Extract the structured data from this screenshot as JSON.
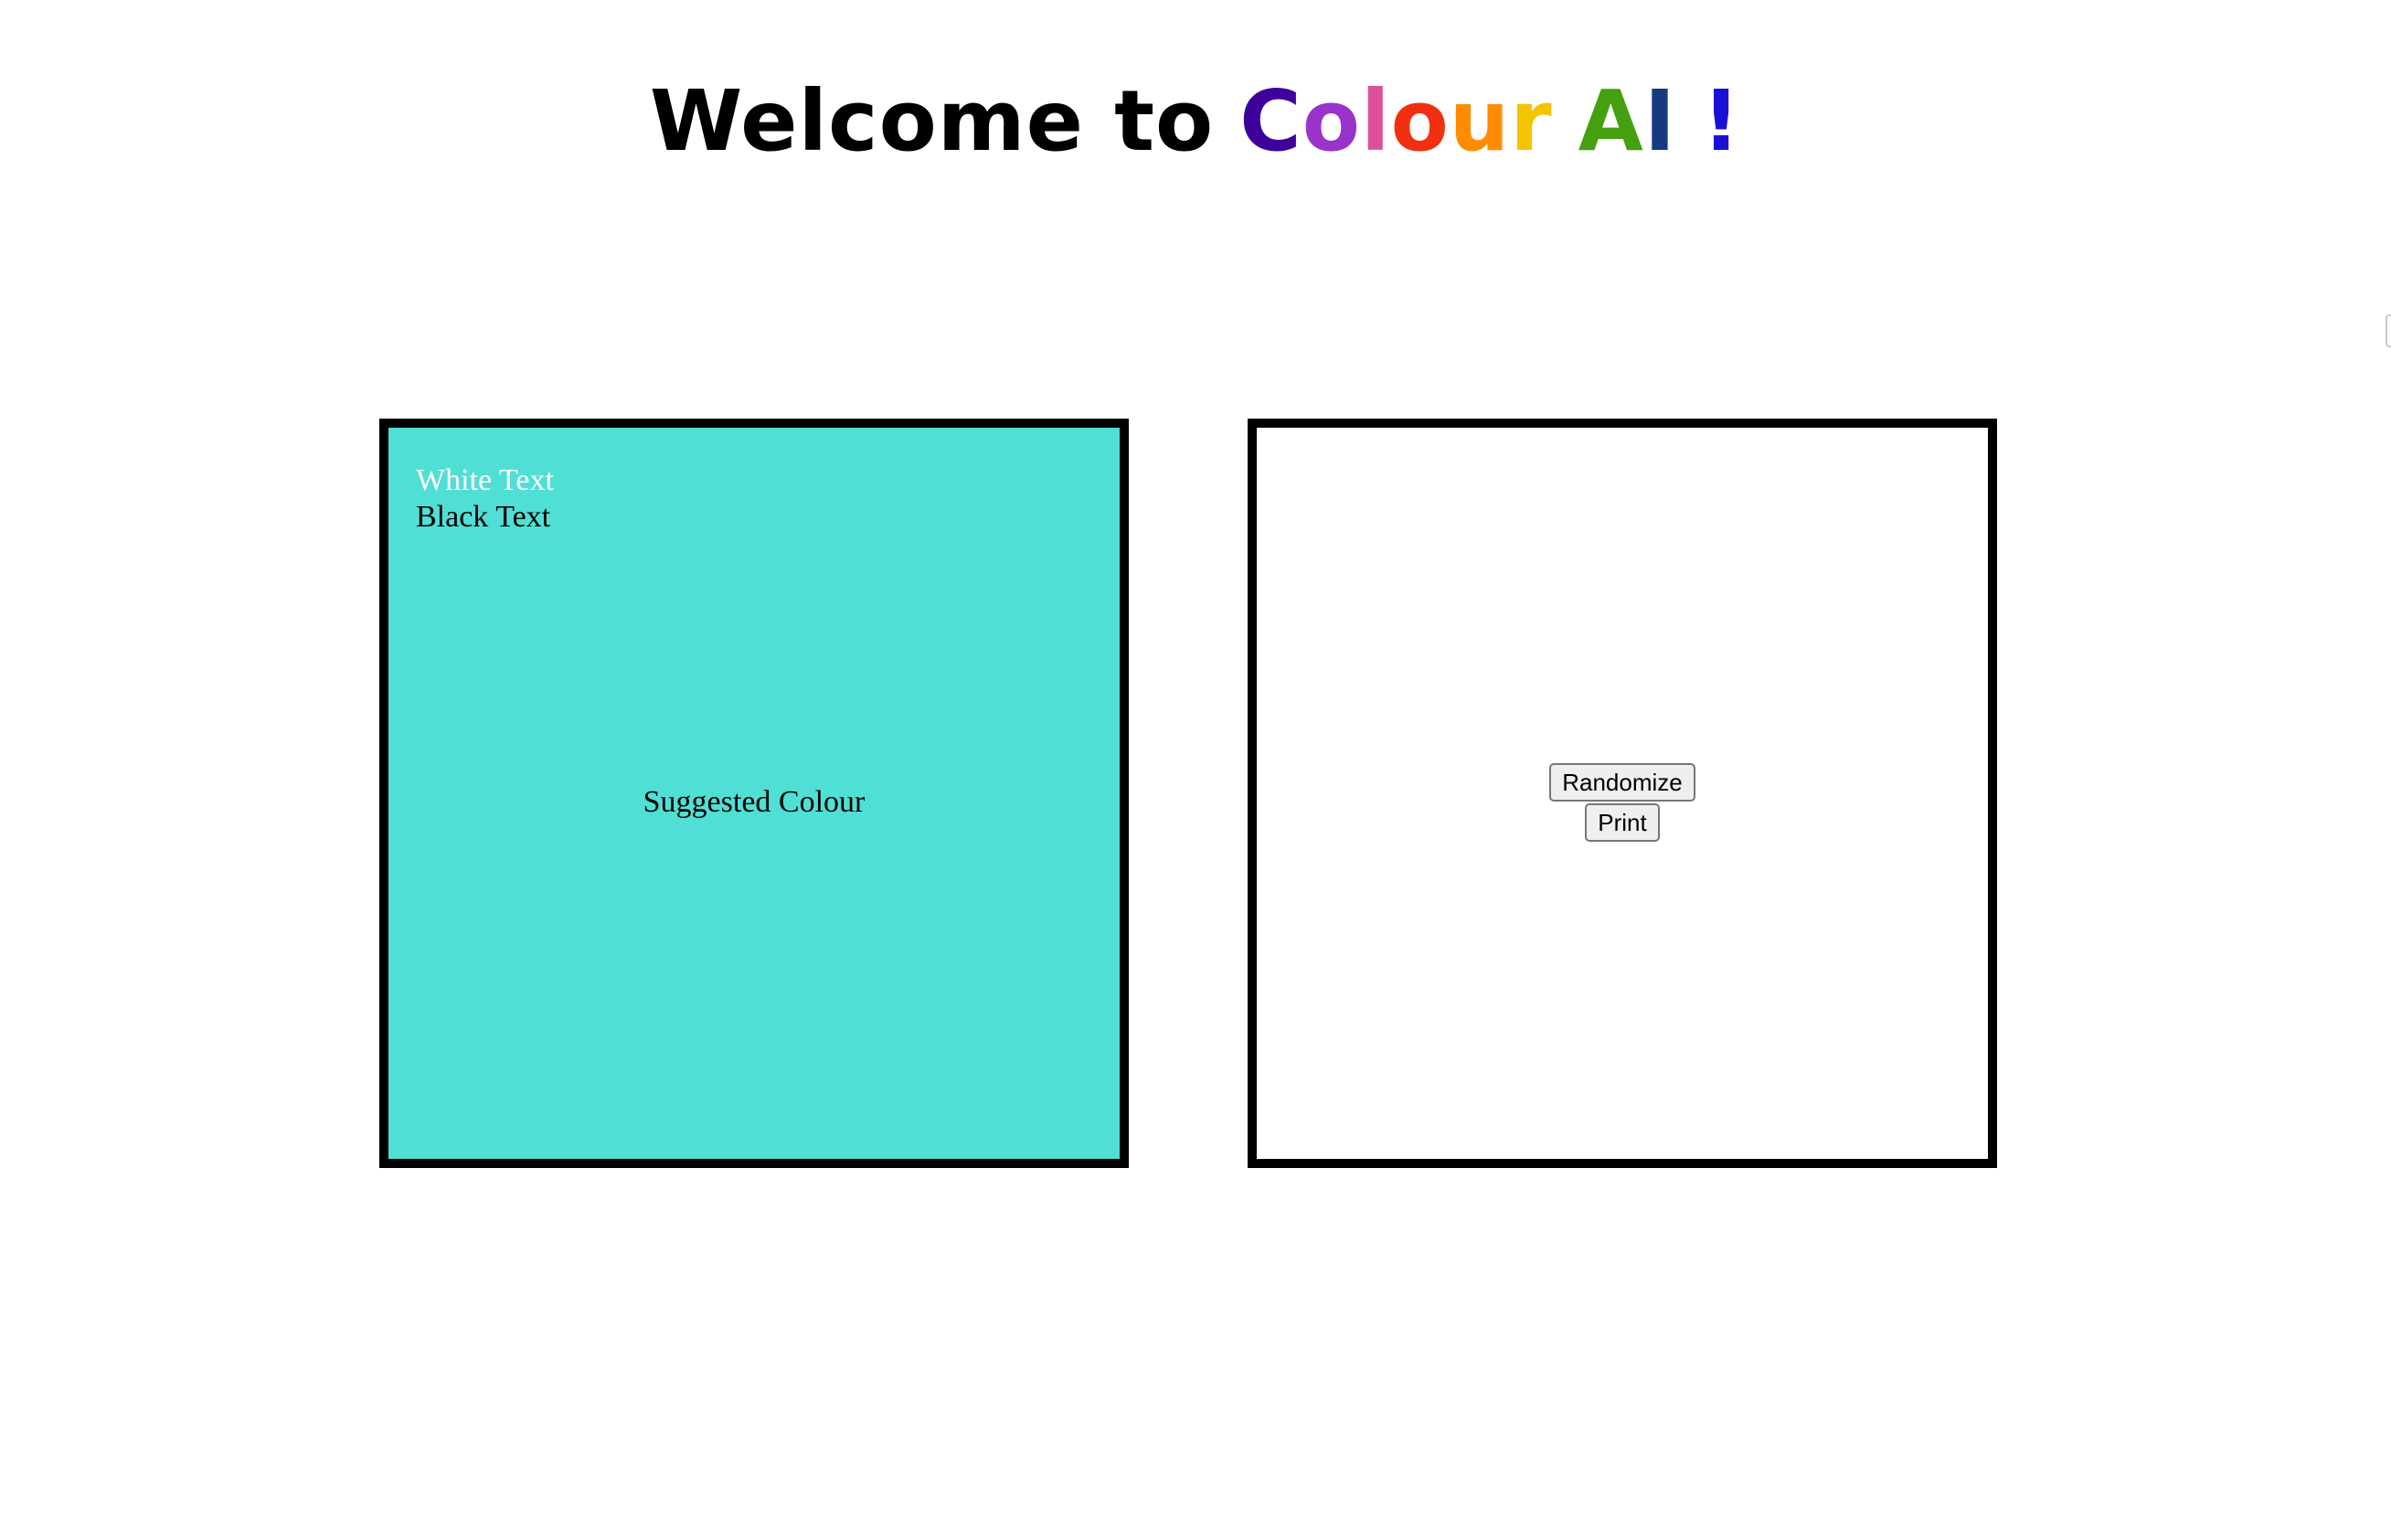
{
  "header": {
    "prefix": "Welcome to",
    "colour_letters": [
      {
        "ch": "C",
        "color": "#3d0099"
      },
      {
        "ch": "o",
        "color": "#9933cc"
      },
      {
        "ch": "l",
        "color": "#e0509a"
      },
      {
        "ch": "o",
        "color": "#f03010"
      },
      {
        "ch": "u",
        "color": "#ff8c00"
      },
      {
        "ch": "r",
        "color": "#f4c400"
      }
    ],
    "ai_letters": [
      {
        "ch": "A",
        "color": "#45a010"
      },
      {
        "ch": "I",
        "color": "#153a80"
      }
    ],
    "exclaim": {
      "ch": "!",
      "color": "#1a0fd6"
    }
  },
  "preview_panel": {
    "background_color": "#50dfd5",
    "white_text_label": "White Text",
    "black_text_label": "Black Text",
    "caption": "Suggested Colour"
  },
  "control_panel": {
    "randomize_label": "Randomize",
    "print_label": "Print"
  }
}
